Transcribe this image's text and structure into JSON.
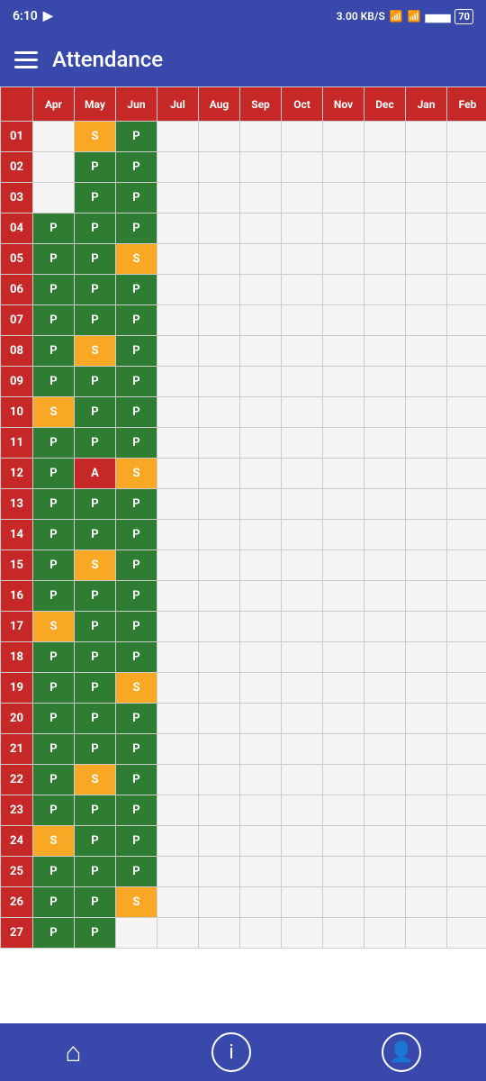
{
  "statusBar": {
    "time": "6:10",
    "networkSpeed": "3.00 KB/S",
    "battery": "70"
  },
  "appBar": {
    "title": "Attendance"
  },
  "table": {
    "months": [
      "Apr",
      "May",
      "Jun",
      "Jul",
      "Aug",
      "Sep",
      "Oct",
      "Nov",
      "Dec",
      "Jan",
      "Feb"
    ],
    "rows": [
      {
        "day": "01",
        "apr": "",
        "may": "S",
        "jun": "P",
        "jul": "",
        "aug": "",
        "sep": "",
        "oct": "",
        "nov": "",
        "dec": "",
        "jan": "",
        "feb": ""
      },
      {
        "day": "02",
        "apr": "",
        "may": "P",
        "jun": "P",
        "jul": "",
        "aug": "",
        "sep": "",
        "oct": "",
        "nov": "",
        "dec": "",
        "jan": "",
        "feb": ""
      },
      {
        "day": "03",
        "apr": "",
        "may": "P",
        "jun": "P",
        "jul": "",
        "aug": "",
        "sep": "",
        "oct": "",
        "nov": "",
        "dec": "",
        "jan": "",
        "feb": ""
      },
      {
        "day": "04",
        "apr": "P",
        "may": "P",
        "jun": "P",
        "jul": "",
        "aug": "",
        "sep": "",
        "oct": "",
        "nov": "",
        "dec": "",
        "jan": "",
        "feb": ""
      },
      {
        "day": "05",
        "apr": "P",
        "may": "P",
        "jun": "S",
        "jul": "",
        "aug": "",
        "sep": "",
        "oct": "",
        "nov": "",
        "dec": "",
        "jan": "",
        "feb": ""
      },
      {
        "day": "06",
        "apr": "P",
        "may": "P",
        "jun": "P",
        "jul": "",
        "aug": "",
        "sep": "",
        "oct": "",
        "nov": "",
        "dec": "",
        "jan": "",
        "feb": ""
      },
      {
        "day": "07",
        "apr": "P",
        "may": "P",
        "jun": "P",
        "jul": "",
        "aug": "",
        "sep": "",
        "oct": "",
        "nov": "",
        "dec": "",
        "jan": "",
        "feb": ""
      },
      {
        "day": "08",
        "apr": "P",
        "may": "S",
        "jun": "P",
        "jul": "",
        "aug": "",
        "sep": "",
        "oct": "",
        "nov": "",
        "dec": "",
        "jan": "",
        "feb": ""
      },
      {
        "day": "09",
        "apr": "P",
        "may": "P",
        "jun": "P",
        "jul": "",
        "aug": "",
        "sep": "",
        "oct": "",
        "nov": "",
        "dec": "",
        "jan": "",
        "feb": ""
      },
      {
        "day": "10",
        "apr": "S",
        "may": "P",
        "jun": "P",
        "jul": "",
        "aug": "",
        "sep": "",
        "oct": "",
        "nov": "",
        "dec": "",
        "jan": "",
        "feb": ""
      },
      {
        "day": "11",
        "apr": "P",
        "may": "P",
        "jun": "P",
        "jul": "",
        "aug": "",
        "sep": "",
        "oct": "",
        "nov": "",
        "dec": "",
        "jan": "",
        "feb": ""
      },
      {
        "day": "12",
        "apr": "P",
        "may": "A",
        "jun": "S",
        "jul": "",
        "aug": "",
        "sep": "",
        "oct": "",
        "nov": "",
        "dec": "",
        "jan": "",
        "feb": ""
      },
      {
        "day": "13",
        "apr": "P",
        "may": "P",
        "jun": "P",
        "jul": "",
        "aug": "",
        "sep": "",
        "oct": "",
        "nov": "",
        "dec": "",
        "jan": "",
        "feb": ""
      },
      {
        "day": "14",
        "apr": "P",
        "may": "P",
        "jun": "P",
        "jul": "",
        "aug": "",
        "sep": "",
        "oct": "",
        "nov": "",
        "dec": "",
        "jan": "",
        "feb": ""
      },
      {
        "day": "15",
        "apr": "P",
        "may": "S",
        "jun": "P",
        "jul": "",
        "aug": "",
        "sep": "",
        "oct": "",
        "nov": "",
        "dec": "",
        "jan": "",
        "feb": ""
      },
      {
        "day": "16",
        "apr": "P",
        "may": "P",
        "jun": "P",
        "jul": "",
        "aug": "",
        "sep": "",
        "oct": "",
        "nov": "",
        "dec": "",
        "jan": "",
        "feb": ""
      },
      {
        "day": "17",
        "apr": "S",
        "may": "P",
        "jun": "P",
        "jul": "",
        "aug": "",
        "sep": "",
        "oct": "",
        "nov": "",
        "dec": "",
        "jan": "",
        "feb": ""
      },
      {
        "day": "18",
        "apr": "P",
        "may": "P",
        "jun": "P",
        "jul": "",
        "aug": "",
        "sep": "",
        "oct": "",
        "nov": "",
        "dec": "",
        "jan": "",
        "feb": ""
      },
      {
        "day": "19",
        "apr": "P",
        "may": "P",
        "jun": "S",
        "jul": "",
        "aug": "",
        "sep": "",
        "oct": "",
        "nov": "",
        "dec": "",
        "jan": "",
        "feb": ""
      },
      {
        "day": "20",
        "apr": "P",
        "may": "P",
        "jun": "P",
        "jul": "",
        "aug": "",
        "sep": "",
        "oct": "",
        "nov": "",
        "dec": "",
        "jan": "",
        "feb": ""
      },
      {
        "day": "21",
        "apr": "P",
        "may": "P",
        "jun": "P",
        "jul": "",
        "aug": "",
        "sep": "",
        "oct": "",
        "nov": "",
        "dec": "",
        "jan": "",
        "feb": ""
      },
      {
        "day": "22",
        "apr": "P",
        "may": "S",
        "jun": "P",
        "jul": "",
        "aug": "",
        "sep": "",
        "oct": "",
        "nov": "",
        "dec": "",
        "jan": "",
        "feb": ""
      },
      {
        "day": "23",
        "apr": "P",
        "may": "P",
        "jun": "P",
        "jul": "",
        "aug": "",
        "sep": "",
        "oct": "",
        "nov": "",
        "dec": "",
        "jan": "",
        "feb": ""
      },
      {
        "day": "24",
        "apr": "S",
        "may": "P",
        "jun": "P",
        "jul": "",
        "aug": "",
        "sep": "",
        "oct": "",
        "nov": "",
        "dec": "",
        "jan": "",
        "feb": ""
      },
      {
        "day": "25",
        "apr": "P",
        "may": "P",
        "jun": "P",
        "jul": "",
        "aug": "",
        "sep": "",
        "oct": "",
        "nov": "",
        "dec": "",
        "jan": "",
        "feb": ""
      },
      {
        "day": "26",
        "apr": "P",
        "may": "P",
        "jun": "S",
        "jul": "",
        "aug": "",
        "sep": "",
        "oct": "",
        "nov": "",
        "dec": "",
        "jan": "",
        "feb": ""
      },
      {
        "day": "27",
        "apr": "P",
        "may": "P",
        "jun": "",
        "jul": "",
        "aug": "",
        "sep": "",
        "oct": "",
        "nov": "",
        "dec": "",
        "jan": "",
        "feb": ""
      }
    ]
  },
  "bottomNav": {
    "homeLabel": "Home",
    "infoLabel": "Info",
    "profileLabel": "Profile"
  }
}
